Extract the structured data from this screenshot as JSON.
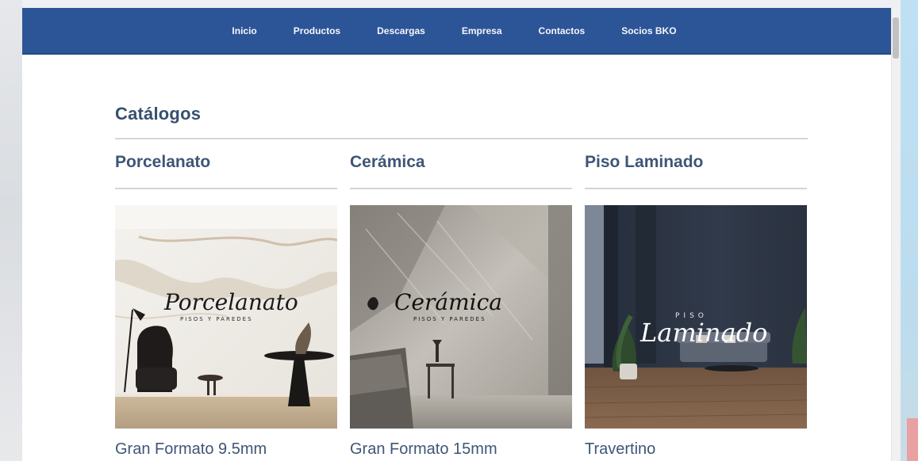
{
  "nav": {
    "items": [
      {
        "label": "Inicio"
      },
      {
        "label": "Productos"
      },
      {
        "label": "Descargas"
      },
      {
        "label": "Empresa"
      },
      {
        "label": "Contactos"
      },
      {
        "label": "Socios BKO"
      }
    ]
  },
  "page": {
    "title": "Catálogos"
  },
  "columns": [
    {
      "heading": "Porcelanato",
      "image": {
        "script": "Porcelanato",
        "tagline": "PISOS Y PAREDES"
      },
      "caption": "Gran Formato 9.5mm"
    },
    {
      "heading": "Cerámica",
      "image": {
        "script": "Cerámica",
        "tagline": "PISOS Y PAREDES"
      },
      "caption": "Gran Formato 15mm"
    },
    {
      "heading": "Piso Laminado",
      "image": {
        "small": "PISO",
        "script": "Laminado"
      },
      "caption": "Travertino"
    }
  ],
  "colors": {
    "navbar": "#2c5597",
    "heading_text": "#3e5677"
  }
}
